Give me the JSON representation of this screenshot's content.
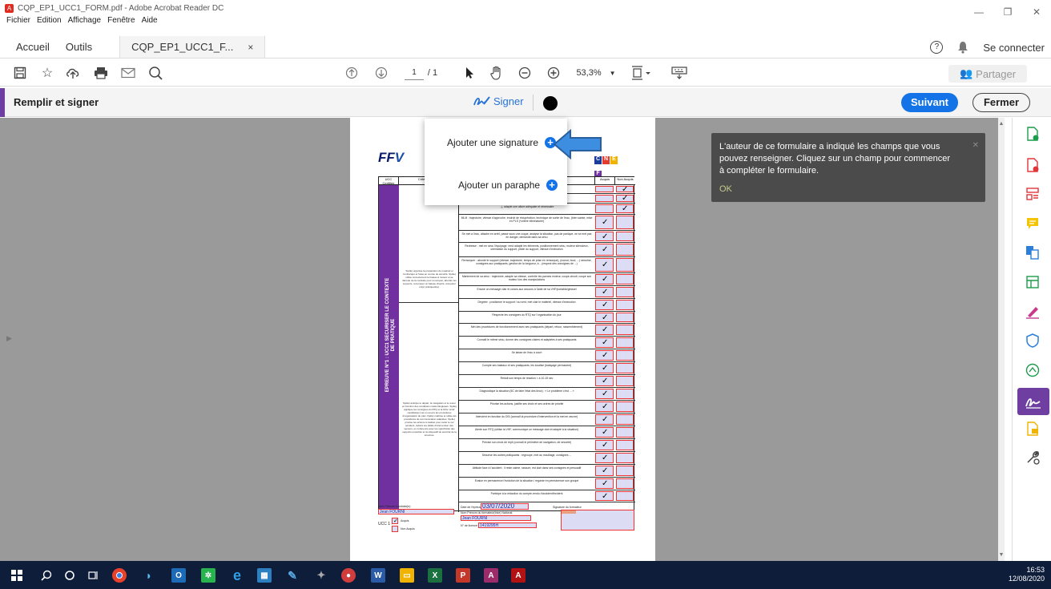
{
  "window": {
    "title": "CQP_EP1_UCC1_FORM.pdf - Adobe Acrobat Reader DC",
    "controls": [
      "—",
      "❐",
      "✕"
    ]
  },
  "menubar": [
    "Fichier",
    "Edition",
    "Affichage",
    "Fenêtre",
    "Aide"
  ],
  "tabs": {
    "home": "Accueil",
    "tools": "Outils",
    "document": "CQP_EP1_UCC1_F...",
    "close": "×",
    "help": "?",
    "connect": "Se connecter"
  },
  "toolbar": {
    "icons": [
      "save-icon",
      "star-icon",
      "upload-icon",
      "print-icon",
      "mail-icon",
      "zoom-search-icon",
      "page-up-icon",
      "page-down-icon",
      "select-arrow-icon",
      "hand-icon",
      "zoom-out-icon",
      "zoom-in-icon",
      "fit-page-icon",
      "keyboard-icon"
    ],
    "page_current": "1",
    "page_total": "/ 1",
    "zoom": "53,3%",
    "share": "Partager"
  },
  "fillsign": {
    "title": "Remplir et signer",
    "sign": "Signer",
    "next": "Suivant",
    "close": "Fermer"
  },
  "popup": {
    "add_signature": "Ajouter une signature",
    "add_initials": "Ajouter un paraphe"
  },
  "tooltip": {
    "message": "L'auteur de ce formulaire a indiqué les champs que vous pouvez renseigner. Cliquez sur un champ pour commencer à compléter le formulaire.",
    "ok": "OK"
  },
  "form": {
    "logo_left": "FF",
    "logo_right": [
      "C",
      "N",
      "E",
      "F"
    ],
    "head_ucc": "UCC Certifiée",
    "head_criteria": "Critères de cer",
    "head_acquis": "Acquis",
    "head_non_acquis": "Non Acquis",
    "ucc_band": "EPREUVE N°1 : UCC1 SECURISER LE CONTEXTE DE PRATIQUE",
    "crit_1": "S(elle) organise la préparation du matériel et l'embarqué et hissé en course de sécurité. S(elle) utilise correctement le bateau à moteur et se déroule de la conduite pour remorquer, aborder les supports, remorquer un bateau chaviré, récupérer un(e) pratiquant(e).",
    "crit_2": "S(elle) anticipe le départ, la navigation et le retour en fonction des conditions météorologiques. S(elle) applique les consignes du RTQ et la fiche 'unité' candidat(e) met en œuvre les procédures d'organisation du plan. Il(elle) maîtrise et utilise les procédures de communication adaptées. S(elle) priorise les actions à réaliser pour éviter le sur accident, réduire les délais d'intervention des secours, en cohérence avec les spécificités des supports encadrés et du dispositif de sécurité de la structure.",
    "rows": [
      {
        "text": "",
        "a": "",
        "b": "✓"
      },
      {
        "text": "...(ation)",
        "a": "",
        "b": "✓"
      },
      {
        "text": "...j, adapte une allure adéquate et nécessaire",
        "a": "",
        "b": "✓"
      },
      {
        "text": "MLM : trajectoire, vitesse d'approche, endroit de récupération, technique de sortie de l'eau, (bien sainte, mise en PLS (*critère éliminatoire)",
        "a": "✓",
        "b": ""
      },
      {
        "text": "Se met à l'eau, attache en arrêt, passe sous une coque, analyse la situation, pas de panique, ne se met pas en danger, demande dans sa sécu",
        "a": "✓",
        "b": ""
      },
      {
        "text": "Redresse : met en sécu l'équipage, rend adapté les éléments, positionnement sécu, moteur silencieux, orientation du support, pilote du support, vitesse d'exécution",
        "a": "✓",
        "b": ""
      },
      {
        "text": "Remorquer : aborde le support (vitesse, trajectoire, temps de prise en remorque), (noeud, bout, ...) sécurise, consignes aux pratiquants, gestion de la longueur, à ...(respect des consignes de ...)",
        "a": "✓",
        "b": ""
      },
      {
        "text": "Maniement de sa sécu : trajectoire, adapte sa vitesse, contrôle les pannes moteur, coupe-circuit, coupe son moteur lors des manipulations",
        "a": "✓",
        "b": ""
      },
      {
        "text": "Envoie un message clair et concis aux secours à l'aide de sa VHF/portable/gestuel",
        "a": "✓",
        "b": ""
      },
      {
        "text": "Dégréer : positionne le support / au vent, met clair le matériel, vitesse d'exécution",
        "a": "✓",
        "b": ""
      },
      {
        "text": "Respecte les consignes du RTQ sur l'organisation du jour",
        "a": "✓",
        "b": ""
      },
      {
        "text": "Met des procédures de fonctionnement avec ses pratiquants (départ, retour, rassemblement)",
        "a": "✓",
        "b": ""
      },
      {
        "text": "Connaît le même sécu, donne des consignes claires et adaptées à ses pratiquants",
        "a": "✓",
        "b": ""
      },
      {
        "text": "Se laisse de l'eau à court",
        "a": "✓",
        "b": ""
      },
      {
        "text": "Compte ses bateaux et ses pratiquants, les localise (balayage permanent)",
        "a": "✓",
        "b": ""
      },
      {
        "text": "Réduit son temps de réaction < à 10-15 sec",
        "a": "✓",
        "b": ""
      },
      {
        "text": "Diagnostique la situation (5C de faire l'état des lieux) : « Le problème c'est ... »",
        "a": "✓",
        "b": ""
      },
      {
        "text": "Priorise les actions, justifie ses choix et ses ordres de priorité",
        "a": "✓",
        "b": ""
      },
      {
        "text": "Intervient en fonction du DSI (connaît la procédure d'intervention et la met en œuvre)",
        "a": "✓",
        "b": ""
      },
      {
        "text": "Alerte son RTQ (utilise la VHF, communique un message clair et adapté à la situation)",
        "a": "✓",
        "b": ""
      },
      {
        "text": "Précise son choix de repli (connaît le périmètre de navigation, de sécurité)",
        "a": "✓",
        "b": ""
      },
      {
        "text": "Sécurise les autres pratiquants : regroupe, met au mouillage, consignes ...",
        "a": "✓",
        "b": ""
      },
      {
        "text": "Attitude face à l'accident : il reste calme, rassure, est clair dans ses consignes et persuadif",
        "a": "✓",
        "b": ""
      },
      {
        "text": "Evalue en permanence l'évolution de la situation / regarde en permanence son groupe",
        "a": "✓",
        "b": ""
      },
      {
        "text": "Participe à la rédaction du compte-rendu d'accident/incident",
        "a": "✓",
        "b": ""
      }
    ],
    "footer": {
      "name_label": "Nom Prénom Candidat(e):",
      "name_value": "Jean FOURNI",
      "date_label": "Date de l'épreuve:",
      "date_value": "03/07/2020",
      "trainer_label": "Nom Prénom du formateur(trice) National:",
      "trainer_value": "Jean FOURNI",
      "license_label": "N° de licence:",
      "license_value": "1419295H",
      "signature_label": "Signature du formateur",
      "ucc_label": "UCC 1 :",
      "acquis_label": "Acquis",
      "non_acquis_label": "Non Acquis",
      "acquis_check": "✓"
    }
  },
  "rail": [
    "export-pdf-icon",
    "create-pdf-icon",
    "organize-icon",
    "comment-icon",
    "combine-icon",
    "compress-icon",
    "fill-sign-icon",
    "protect-icon",
    "send-icon",
    "sign-icon",
    "scan-icon",
    "tools-icon"
  ],
  "taskbar": {
    "time": "16:53",
    "date": "12/08/2020"
  }
}
